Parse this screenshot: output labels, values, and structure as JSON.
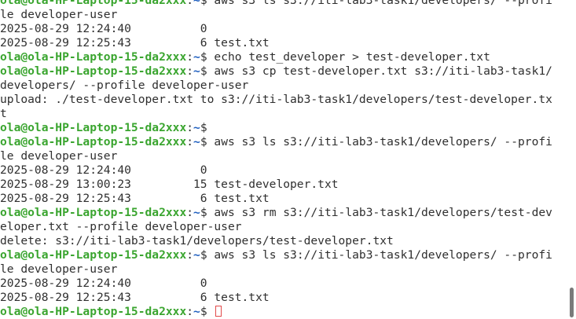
{
  "prompt": {
    "user": "ola@ola-HP-Laptop-15-da2xxx",
    "sep": ":",
    "path": "~",
    "symbol": "$"
  },
  "lines": [
    {
      "type": "cmd",
      "text": " aws s3 ls s3://iti-lab3-task1/developers/ --profi"
    },
    {
      "type": "out",
      "text": "le developer-user"
    },
    {
      "type": "out",
      "text": "2025-08-29 12:24:40          0"
    },
    {
      "type": "out",
      "text": "2025-08-29 12:25:43          6 test.txt"
    },
    {
      "type": "cmd",
      "text": " echo test_developer > test-developer.txt"
    },
    {
      "type": "cmd",
      "text": " aws s3 cp test-developer.txt s3://iti-lab3-task1/"
    },
    {
      "type": "out",
      "text": "developers/ --profile developer-user"
    },
    {
      "type": "out",
      "text": "upload: ./test-developer.txt to s3://iti-lab3-task1/developers/test-developer.tx"
    },
    {
      "type": "out",
      "text": "t"
    },
    {
      "type": "cmd",
      "text": ""
    },
    {
      "type": "cmd",
      "text": " aws s3 ls s3://iti-lab3-task1/developers/ --profi"
    },
    {
      "type": "out",
      "text": "le developer-user"
    },
    {
      "type": "out",
      "text": "2025-08-29 12:24:40          0"
    },
    {
      "type": "out",
      "text": "2025-08-29 13:00:23         15 test-developer.txt"
    },
    {
      "type": "out",
      "text": "2025-08-29 12:25:43          6 test.txt"
    },
    {
      "type": "cmd",
      "text": " aws s3 rm s3://iti-lab3-task1/developers/test-dev"
    },
    {
      "type": "out",
      "text": "eloper.txt --profile developer-user"
    },
    {
      "type": "out",
      "text": "delete: s3://iti-lab3-task1/developers/test-developer.txt"
    },
    {
      "type": "cmd",
      "text": " aws s3 ls s3://iti-lab3-task1/developers/ --profi"
    },
    {
      "type": "out",
      "text": "le developer-user"
    },
    {
      "type": "out",
      "text": "2025-08-29 12:24:40          0"
    },
    {
      "type": "out",
      "text": "2025-08-29 12:25:43          6 test.txt"
    },
    {
      "type": "cmd",
      "text": " ",
      "cursor": true
    }
  ],
  "colors": {
    "prompt_user": "#3aa52f",
    "prompt_path": "#1f5fbf",
    "text": "#2f2f2f",
    "cursor": "#e24a4a"
  }
}
